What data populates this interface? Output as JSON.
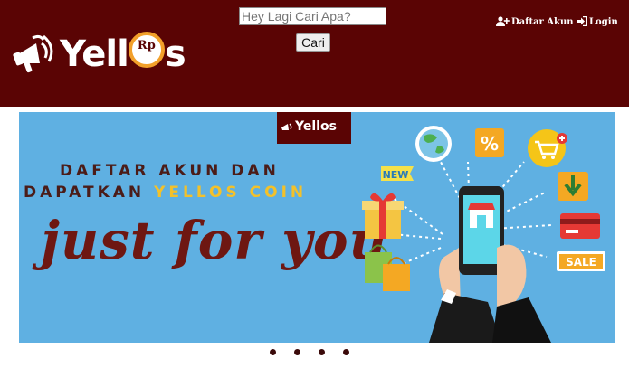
{
  "brand": {
    "name": "Yell",
    "name_tail": "s",
    "coin_symbol": "Rp"
  },
  "search": {
    "placeholder": "Hey Lagi Cari Apa?",
    "button_label": "Cari"
  },
  "nav": {
    "register_label": "Daftar Akun",
    "login_label": "Login"
  },
  "banner": {
    "headline_line1": "DAFTAR AKUN DAN",
    "headline_line2_prefix": "DAPATKAN ",
    "headline_line2_highlight": "YELLOS COIN",
    "script_text": "just for you",
    "badge_new": "NEW",
    "badge_percent": "%",
    "badge_sale": "SALE",
    "mini_logo": "Yellos"
  },
  "carousel": {
    "slide_count": 4
  },
  "colors": {
    "header_bg": "#5a0404",
    "banner_bg": "#5fb0e2",
    "accent": "#f3c12a",
    "dot": "#3b0a0a"
  }
}
